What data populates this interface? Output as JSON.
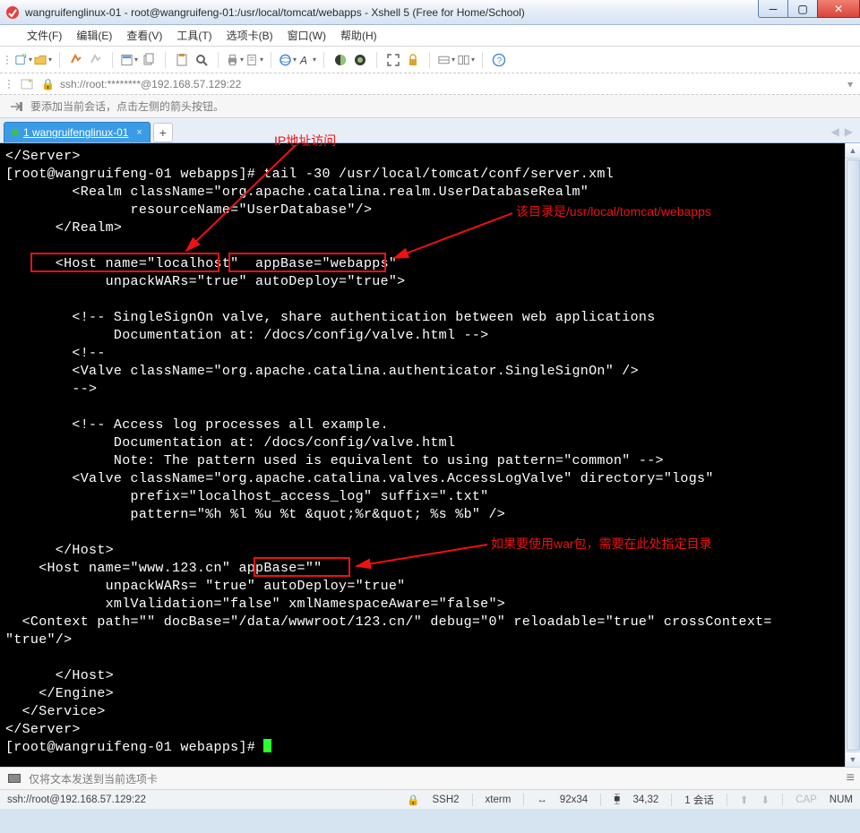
{
  "window": {
    "title": "wangruifenglinux-01 - root@wangruifeng-01:/usr/local/tomcat/webapps - Xshell 5 (Free for Home/School)"
  },
  "menu": {
    "items": [
      "文件(F)",
      "编辑(E)",
      "查看(V)",
      "工具(T)",
      "选项卡(B)",
      "窗口(W)",
      "帮助(H)"
    ]
  },
  "address": {
    "text": "ssh://root:********@192.168.57.129:22"
  },
  "hint": {
    "text": "要添加当前会话，点击左侧的箭头按钮。"
  },
  "tab": {
    "label": "1  wangruifenglinux-01"
  },
  "annotations": {
    "ip_label": "IP地址访问",
    "dir_label": "该目录是/usr/local/tomcat/webapps",
    "war_label": "如果要使用war包，需要在此处指定目录"
  },
  "terminal": {
    "lines": [
      "</Server>",
      "[root@wangruifeng-01 webapps]# tail -30 /usr/local/tomcat/conf/server.xml",
      "        <Realm className=\"org.apache.catalina.realm.UserDatabaseRealm\"",
      "               resourceName=\"UserDatabase\"/>",
      "      </Realm>",
      "",
      "      <Host name=\"localhost\"  appBase=\"webapps\"",
      "            unpackWARs=\"true\" autoDeploy=\"true\">",
      "",
      "        <!-- SingleSignOn valve, share authentication between web applications",
      "             Documentation at: /docs/config/valve.html -->",
      "        <!--",
      "        <Valve className=\"org.apache.catalina.authenticator.SingleSignOn\" />",
      "        -->",
      "",
      "        <!-- Access log processes all example.",
      "             Documentation at: /docs/config/valve.html",
      "             Note: The pattern used is equivalent to using pattern=\"common\" -->",
      "        <Valve className=\"org.apache.catalina.valves.AccessLogValve\" directory=\"logs\"",
      "               prefix=\"localhost_access_log\" suffix=\".txt\"",
      "               pattern=\"%h %l %u %t &quot;%r&quot; %s %b\" />",
      "",
      "      </Host>",
      "    <Host name=\"www.123.cn\" appBase=\"\"",
      "            unpackWARs= \"true\" autoDeploy=\"true\"",
      "            xmlValidation=\"false\" xmlNamespaceAware=\"false\">",
      "  <Context path=\"\" docBase=\"/data/wwwroot/123.cn/\" debug=\"0\" reloadable=\"true\" crossContext=",
      "\"true\"/>",
      "",
      "      </Host>",
      "    </Engine>",
      "  </Service>",
      "</Server>"
    ],
    "prompt": "[root@wangruifeng-01 webapps]# "
  },
  "send_row": {
    "text": "仅将文本发送到当前选项卡"
  },
  "status": {
    "conn": "ssh://root@192.168.57.129:22",
    "proto": "SSH2",
    "term": "xterm",
    "size": "92x34",
    "size_icon": "↔",
    "pos": "34,32",
    "pos_icon": "⧯",
    "sessions": "1 会话",
    "caps": "CAP",
    "num": "NUM"
  }
}
